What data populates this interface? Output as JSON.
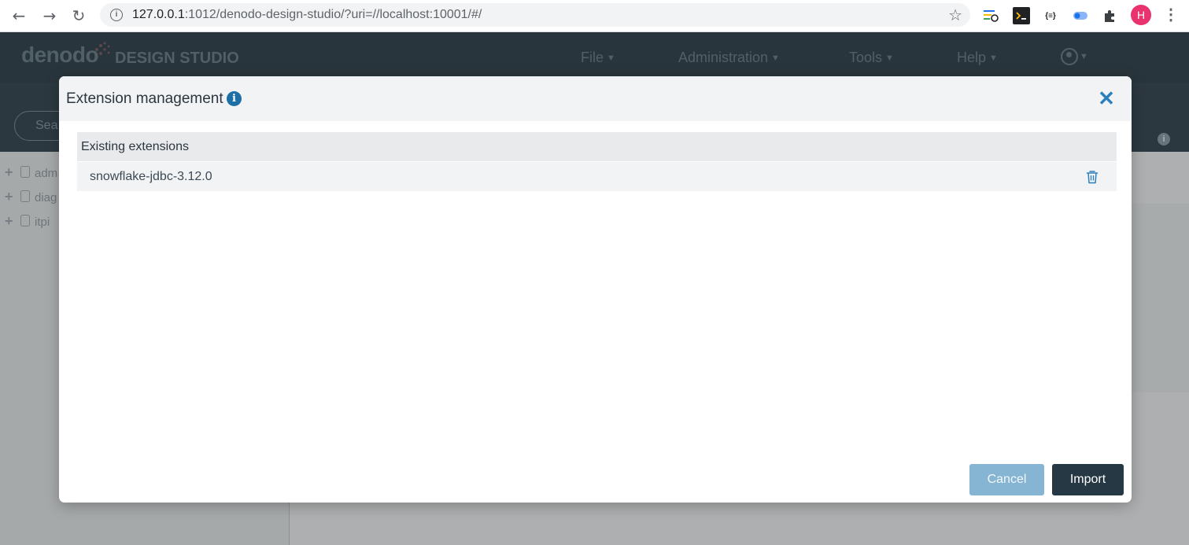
{
  "browser": {
    "url_host": "127.0.0.1",
    "url_path": ":1012/denodo-design-studio/?uri=//localhost:10001/#/",
    "profile_initial": "H",
    "ext_json_label": "{≡}"
  },
  "app": {
    "logo_text": "denodo",
    "logo_subtitle": "DESIGN STUDIO",
    "menu": {
      "file": "File",
      "administration": "Administration",
      "tools": "Tools",
      "help": "Help"
    },
    "search_placeholder": "Sea",
    "tree": [
      {
        "label": "adm"
      },
      {
        "label": "diag"
      },
      {
        "label": "itpi"
      }
    ]
  },
  "modal": {
    "title": "Extension management",
    "table_header": "Existing extensions",
    "extensions": [
      {
        "name": "snowflake-jdbc-3.12.0"
      }
    ],
    "cancel_label": "Cancel",
    "import_label": "Import"
  },
  "colors": {
    "accent_blue": "#2c7fbd",
    "primary_dark": "#263844",
    "cancel_blue": "#86b5d4"
  }
}
